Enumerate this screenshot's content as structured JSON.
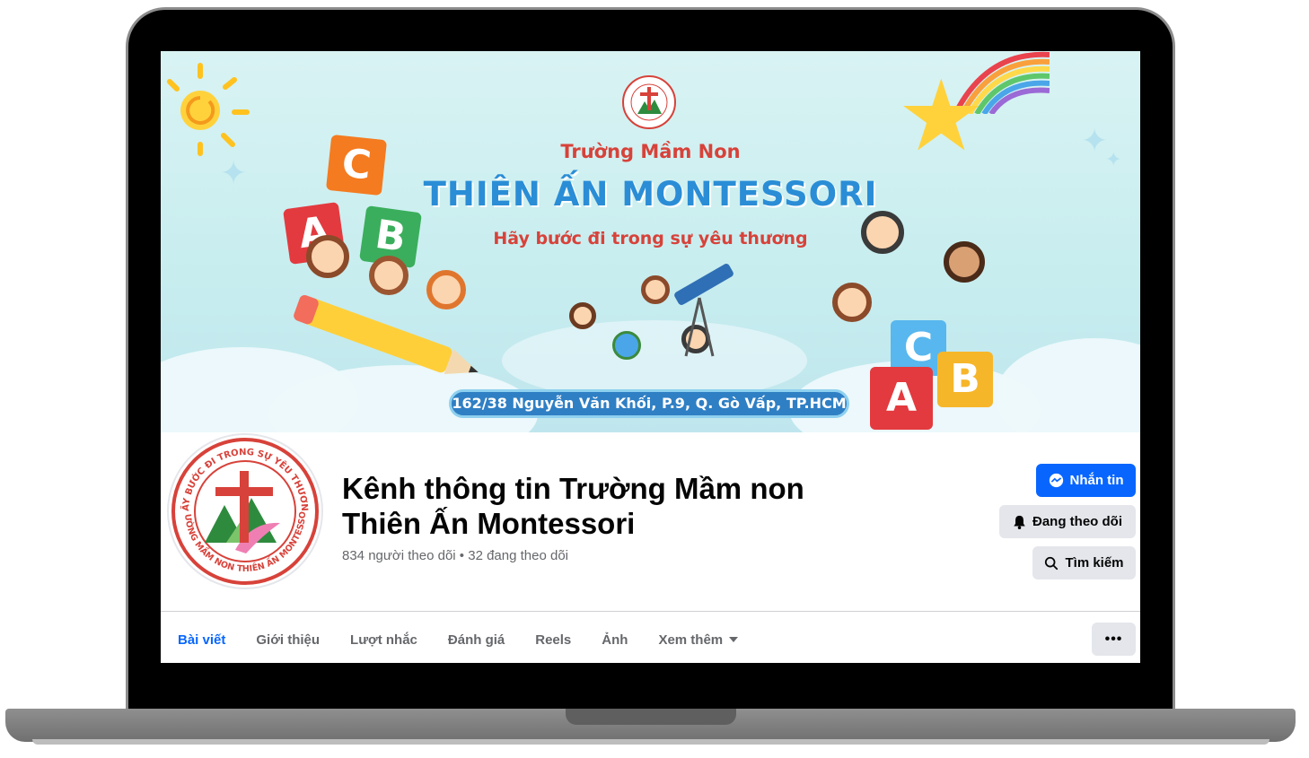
{
  "cover": {
    "subtitle": "Trường Mầm Non",
    "title": "THIÊN ẤN MONTESSORI",
    "slogan": "Hãy bước đi trong sự yêu thương",
    "address": "162/38 Nguyễn Văn Khối, P.9, Q. Gò Vấp, TP.HCM",
    "letters": [
      "C",
      "A",
      "B",
      "C",
      "A",
      "B"
    ]
  },
  "profile": {
    "logo_text_top": "HÃY BƯỚC ĐI TRONG SỰ YÊU THƯƠNG",
    "logo_text_bottom": "TRƯỜNG MẦM NON THIÊN ẤN MONTESSORI",
    "name_line1": "Kênh thông tin Trường Mầm non",
    "name_line2": "Thiên Ấn Montessori",
    "stats": "834 người theo dõi • 32 đang theo dõi"
  },
  "actions": {
    "message_label": "Nhắn tin",
    "following_label": "Đang theo dõi",
    "search_label": "Tìm kiếm",
    "more_label": "•••"
  },
  "tabs": [
    {
      "label": "Bài viết",
      "active": true
    },
    {
      "label": "Giới thiệu",
      "active": false
    },
    {
      "label": "Lượt nhắc",
      "active": false
    },
    {
      "label": "Đánh giá",
      "active": false
    },
    {
      "label": "Reels",
      "active": false
    },
    {
      "label": "Ảnh",
      "active": false
    },
    {
      "label": "Xem thêm",
      "active": false
    }
  ],
  "colors": {
    "accent": "#0866ff",
    "secondary_button": "#e4e6eb",
    "muted_text": "#65676b",
    "brand_red": "#d7423a",
    "brand_blue": "#2a8dd6"
  },
  "icons": {
    "message": "messenger-icon",
    "following": "bell-icon",
    "search": "search-icon",
    "dropdown": "caret-down-icon"
  }
}
